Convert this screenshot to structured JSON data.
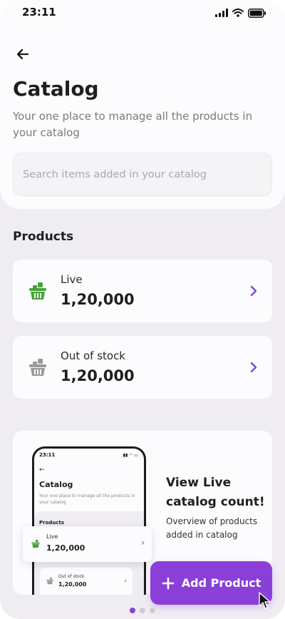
{
  "status_bar": {
    "time": "23:11"
  },
  "header": {
    "title": "Catalog",
    "subtitle": "Your one place to manage all the products in your catalog"
  },
  "search": {
    "placeholder": "Search items added in your catalog",
    "value": ""
  },
  "products": {
    "section_title": "Products",
    "items": [
      {
        "label": "Live",
        "value": "1,20,000",
        "icon": "basket-icon",
        "icon_color": "#49a23b"
      },
      {
        "label": "Out of stock",
        "value": "1,20,000",
        "icon": "basket-icon",
        "icon_color": "#9a9a9a"
      }
    ]
  },
  "promo": {
    "title": "View Live catalog count!",
    "description": "Overview of products added in catalog",
    "mockup": {
      "time": "23:11",
      "title": "Catalog",
      "subtitle": "Your one place to manage all the products in your catalog",
      "section_title": "Products",
      "live_label": "Live",
      "live_value": "1,20,000",
      "oos_label": "Out of stock",
      "oos_value": "1,20,000"
    }
  },
  "carousel": {
    "pages": 3,
    "active_page": 1
  },
  "add_button": {
    "label": "Add Product"
  },
  "colors": {
    "accent": "#8a3fd8",
    "chevron": "#7a4bd6",
    "live_icon": "#49a23b",
    "oos_icon": "#9a9a9a",
    "background": "#efedf1",
    "card": "#fcfbfd"
  }
}
